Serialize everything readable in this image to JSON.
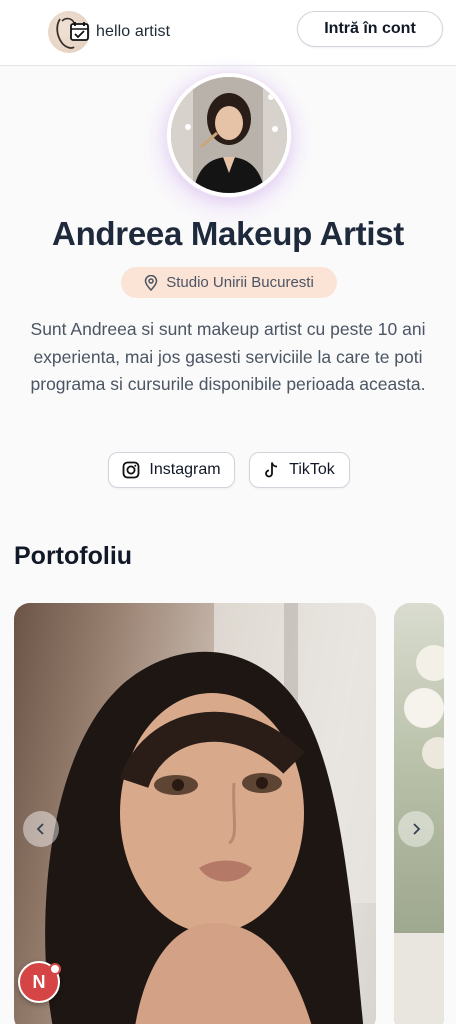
{
  "header": {
    "logo_text": "hello artist",
    "login_label": "Intră în cont"
  },
  "profile": {
    "name": "Andreea Makeup Artist",
    "location": "Studio Unirii Bucuresti",
    "bio": "Sunt Andreea si sunt makeup artist cu peste 10 ani experienta, mai jos gasesti serviciile la care te poti programa si cursurile disponibile perioada aceasta.",
    "social": [
      {
        "label": "Instagram",
        "icon": "instagram-icon"
      },
      {
        "label": "TikTok",
        "icon": "tiktok-icon"
      }
    ]
  },
  "portfolio": {
    "title": "Portofoliu"
  },
  "fab": {
    "letter": "N"
  },
  "colors": {
    "location_badge_bg": "#fbe3d6",
    "fab_red": "#d64545",
    "title_navy": "#1e293b"
  }
}
